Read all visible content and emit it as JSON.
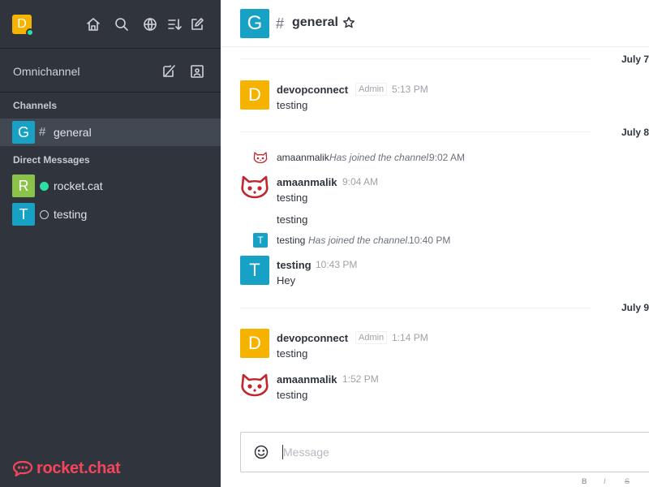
{
  "sidebar": {
    "user_initial": "D",
    "omnichannel_label": "Omnichannel",
    "channels_title": "Channels",
    "channels": [
      {
        "initial": "G",
        "prefix": "#",
        "name": "general",
        "color": "#17a2c5"
      }
    ],
    "dm_title": "Direct Messages",
    "direct_messages": [
      {
        "initial": "R",
        "name": "rocket.cat",
        "color": "#8bc34a",
        "status": "online"
      },
      {
        "initial": "T",
        "name": "testing",
        "color": "#17a2c5",
        "status": "offline"
      }
    ],
    "logo_text": "rocket.chat"
  },
  "header": {
    "initial": "G",
    "hash": "#",
    "title": "general"
  },
  "days": [
    "July 7,",
    "July 8,",
    "July 9,"
  ],
  "messages": [
    {
      "initial": "D",
      "user": "devopconnect",
      "role": "Admin",
      "time": "5:13 PM",
      "body": "testing"
    },
    {
      "user": "amaanmalik",
      "time": "9:04 AM",
      "body": "testing",
      "followup": "testing"
    },
    {
      "initial": "T",
      "user": "testing",
      "time": "10:43 PM",
      "body": "Hey"
    },
    {
      "initial": "D",
      "user": "devopconnect",
      "role": "Admin",
      "time": "1:14 PM",
      "body": "testing"
    },
    {
      "user": "amaanmalik",
      "time": "1:52 PM",
      "body": "testing"
    }
  ],
  "system": [
    {
      "user": "amaanmalik",
      "text": "Has joined the channel.",
      "time": "9:02 AM"
    },
    {
      "initial": "T",
      "user": "testing",
      "text": "Has joined the channel.",
      "time": "10:40 PM"
    }
  ],
  "composer": {
    "placeholder": "Message",
    "format_buttons": [
      "B",
      "I",
      "S"
    ]
  },
  "colors": {
    "sidebar_bg": "#2f343d",
    "accent_yellow": "#f5b300",
    "accent_teal": "#17a2c5",
    "online": "#2de0a5",
    "brand_red": "#f5455c"
  }
}
